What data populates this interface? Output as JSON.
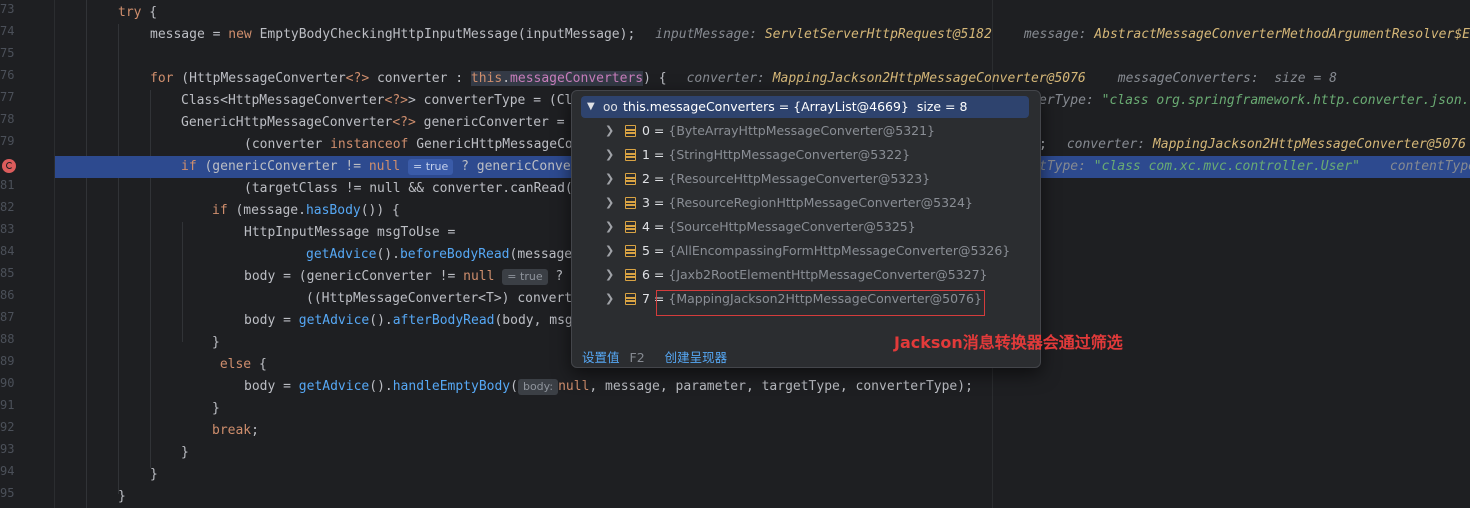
{
  "line_numbers": [
    "73",
    "74",
    "75",
    "76",
    "77",
    "78",
    "79",
    "80",
    "81",
    "82",
    "83",
    "84",
    "85",
    "86",
    "87",
    "88",
    "89",
    "90",
    "91",
    "92",
    "93",
    "94",
    "95"
  ],
  "code": {
    "l73": {
      "kw_try": "try",
      "brace": " {"
    },
    "l74": {
      "a": "message = ",
      "kw_new": "new",
      "b": " EmptyBodyCheckingHttpInputMessage(",
      "c": "inputMessage",
      "d": ");",
      "h1_name": "inputMessage: ",
      "h1_val": "ServletServerHttpRequest@5182",
      "h2_name": "message: ",
      "h2_val": "AbstractMessageConverterMethodArgumentResolver$Em"
    },
    "l76": {
      "kw_for": "for",
      "a": " (HttpMessageConverter",
      "gen": "<?>",
      "b": " converter : ",
      "this_kw": "this",
      "dot": ".",
      "fld": "messageConverters",
      "c": ") {",
      "h1_name": "converter: ",
      "h1_val": "MappingJackson2HttpMessageConverter@5076",
      "h2_name": "messageConverters: ",
      "h2_val": " size = 8"
    },
    "l77": {
      "a": "Class<HttpMessageConverter",
      "gen": "<?>",
      "b": "> converterType = (Cl",
      "h_name": "erType: ",
      "h_val": "\"class org.springframework.http.converter.json."
    },
    "l78": {
      "a": "GenericHttpMessageConverter",
      "gen": "<?>",
      "b": " genericConverter = "
    },
    "l79": {
      "a": "(converter ",
      "kw_inst": "instanceof",
      "b": " GenericHttpMessageCo",
      "semi": ";",
      "h_name": "converter: ",
      "h_val": "MappingJackson2HttpMessageConverter@5076"
    },
    "l80": {
      "kw_if": "if",
      "a": " (genericConverter != ",
      "kw_null": "null",
      "badge": "= true",
      "b": " ? genericConver",
      "h1_name": "tType: ",
      "h1_val": "\"class com.xc.mvc.controller.User\"",
      "h2_name": "contentType"
    },
    "l81": {
      "a": "(targetClass != null && converter.canRead("
    },
    "l82": {
      "kw_if": "if",
      "a": " (message.",
      "fn": "hasBody",
      "b": "()) {"
    },
    "l83": {
      "a": "HttpInputMessage msgToUse ="
    },
    "l84": {
      "fn1": "getAdvice",
      "a": "().",
      "fn2": "beforeBodyRead",
      "b": "(message"
    },
    "l85": {
      "a": "body = (genericConverter != ",
      "kw_null": "null",
      "badge": "= true",
      "b": " ? g"
    },
    "l86": {
      "a": "((HttpMessageConverter<T>) convert"
    },
    "l87": {
      "a": "body = ",
      "fn1": "getAdvice",
      "b": "().",
      "fn2": "afterBodyRead",
      "c": "(body, msg"
    },
    "l88": {
      "a": "}"
    },
    "l89": {
      "kw_else": " else",
      "a": " {"
    },
    "l90": {
      "a": "body = ",
      "fn1": "getAdvice",
      "b": "().",
      "fn2": "handleEmptyBody",
      "c": "(",
      "badge": "body:",
      "kw_null": "null",
      "d": ", message, parameter, targetType, converterType);"
    },
    "l91": {
      "a": "}"
    },
    "l92": {
      "kw_break": "break",
      "a": ";"
    },
    "l93": {
      "a": "}"
    },
    "l94": {
      "a": "}"
    },
    "l95": {
      "a": "}"
    }
  },
  "popup": {
    "root": "this.messageConverters = {ArrayList@4669}  size = 8",
    "items": [
      {
        "idx": "0 = ",
        "val": "{ByteArrayHttpMessageConverter@5321}"
      },
      {
        "idx": "1 = ",
        "val": "{StringHttpMessageConverter@5322}"
      },
      {
        "idx": "2 = ",
        "val": "{ResourceHttpMessageConverter@5323}"
      },
      {
        "idx": "3 = ",
        "val": "{ResourceRegionHttpMessageConverter@5324}"
      },
      {
        "idx": "4 = ",
        "val": "{SourceHttpMessageConverter@5325}"
      },
      {
        "idx": "5 = ",
        "val": "{AllEncompassingFormHttpMessageConverter@5326}"
      },
      {
        "idx": "6 = ",
        "val": "{Jaxb2RootElementHttpMessageConverter@5327}"
      },
      {
        "idx": "7 = ",
        "val": "{MappingJackson2HttpMessageConverter@5076}"
      }
    ],
    "set_value": "设置值",
    "set_value_key": "F2",
    "create_renderer": "创建呈现器"
  },
  "annotation": "Jackson消息转换器会通过筛选",
  "colors": {
    "highlight_line": "#2d4a8f",
    "breakpoint": "#db5c5c",
    "annotation": "#e23a3a",
    "red_box": "#d43c3c"
  }
}
